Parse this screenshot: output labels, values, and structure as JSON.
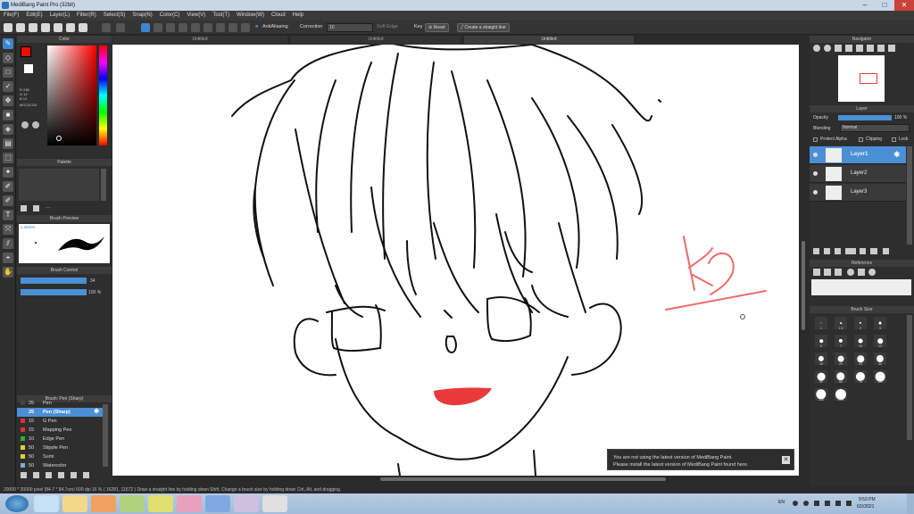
{
  "window": {
    "title": "MediBang Paint Pro (32bit)"
  },
  "menu": [
    "File(F)",
    "Edit(E)",
    "Layer(L)",
    "Filter(R)",
    "Select(S)",
    "Snap(N)",
    "Color(C)",
    "View(V)",
    "Tool(T)",
    "Window(W)",
    "Cloud",
    "Help"
  ],
  "toolbar": {
    "antialiasing_label": "AntiAliasing",
    "correction_label": "Correction",
    "correction_value": "10",
    "soft_edge_label": "Soft Edge",
    "key_label": "Key",
    "reset_label": "Reset",
    "straight_line_label": "Create a straight line"
  },
  "tabs": [
    "Untitled",
    "Untitled",
    "Untitled"
  ],
  "left": {
    "color_title": "Color",
    "color_values": [
      "R 236",
      "G 12",
      "B 12"
    ],
    "hex_value": "#ECOCOC",
    "palette_title": "Palette",
    "brush_preview_title": "Brush Preview",
    "brush_preview_size": "1.46mm",
    "brush_control_title": "Brush Control",
    "brush_size_value": "34",
    "brush_opacity_value": "100 %",
    "brush_list_title": "Brush: Pen (Sharp)",
    "brushes": [
      {
        "size": "25",
        "name": "Pen",
        "color": "#444444",
        "selected": false
      },
      {
        "size": "25",
        "name": "Pen (Sharp)",
        "color": "#4b8fd4",
        "selected": true
      },
      {
        "size": "15",
        "name": "G Pen",
        "color": "#e03030",
        "selected": false
      },
      {
        "size": "15",
        "name": "Mapping Pen",
        "color": "#e03030",
        "selected": false
      },
      {
        "size": "10",
        "name": "Edge Pen",
        "color": "#30b030",
        "selected": false
      },
      {
        "size": "50",
        "name": "Stipple Pen",
        "color": "#e0d030",
        "selected": false
      },
      {
        "size": "50",
        "name": "Sumi",
        "color": "#e0d030",
        "selected": false
      },
      {
        "size": "50",
        "name": "Watercolor",
        "color": "#6fb0e0",
        "selected": false
      }
    ]
  },
  "right": {
    "navigator_title": "Navigator",
    "layer_title": "Layer",
    "opacity_label": "Opacity",
    "opacity_value": "100 %",
    "blending_label": "Blending",
    "blending_value": "Normal",
    "protect_alpha_label": "Protect Alpha",
    "clipping_label": "Clipping",
    "lock_label": "Lock",
    "layers": [
      "Layer1",
      "Layer2",
      "Layer3"
    ],
    "reference_title": "Reference",
    "brush_size_title": "Brush Size",
    "brush_sizes": [
      "1",
      "1.5",
      "2",
      "3",
      "5",
      "7",
      "10",
      "13",
      "15",
      "20",
      "25",
      "30",
      "40",
      "50",
      "70",
      "100",
      "150",
      "200"
    ]
  },
  "notice": {
    "line1": "You are not using the latest version of MediBang Paint.",
    "line2": "Please install the latest version of MediBang Paint found here."
  },
  "status": {
    "text": "20000 * 20000 pixel  (84.7 * 84.7cm)  600 dpi  16 %  ( 16281, 11572 )  Draw a straight line by holding down Shift, Change a brush size by holding down Ctrl, Alt, and dragging"
  },
  "taskbar": {
    "lang": "EN",
    "time": "9:53 PM",
    "date": "6/2/2021"
  },
  "colors": {
    "accent": "#4b8fd4",
    "lips": "#e83a3a",
    "sketch_red": "#ee6b6b"
  }
}
